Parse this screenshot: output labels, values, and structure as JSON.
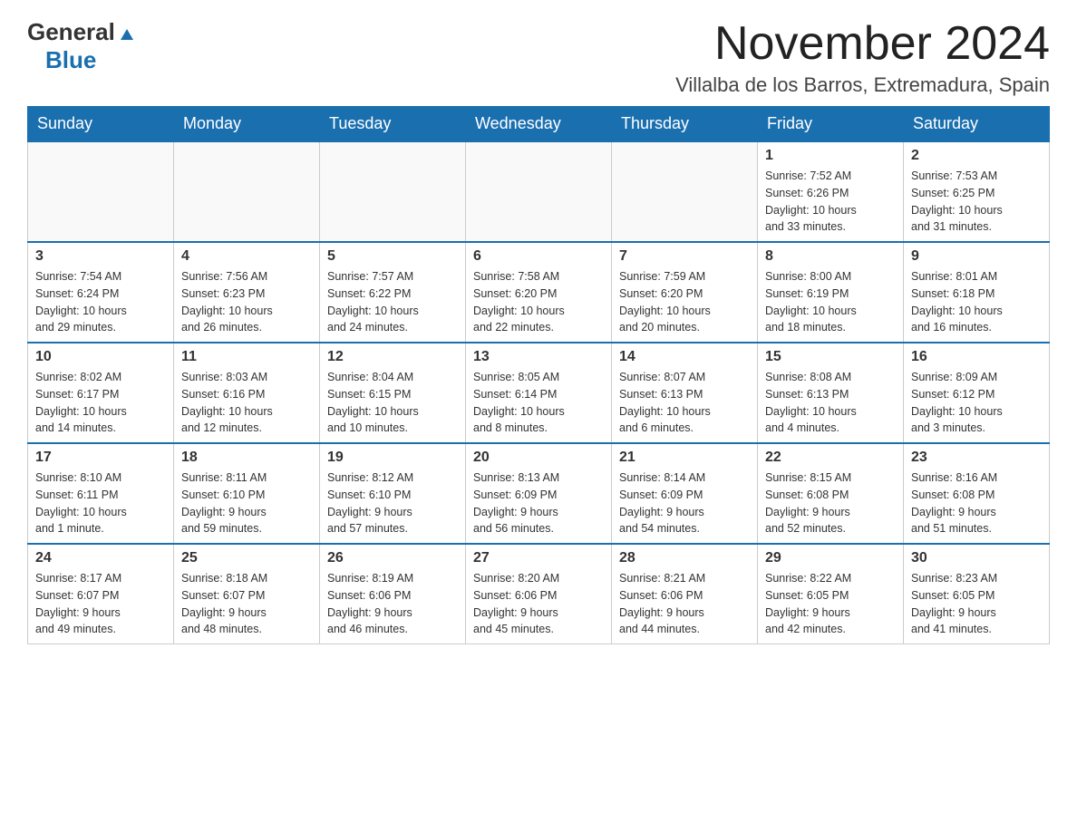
{
  "logo": {
    "general": "General",
    "triangle": "▲",
    "blue": "Blue"
  },
  "header": {
    "month_year": "November 2024",
    "location": "Villalba de los Barros, Extremadura, Spain"
  },
  "days_of_week": [
    "Sunday",
    "Monday",
    "Tuesday",
    "Wednesday",
    "Thursday",
    "Friday",
    "Saturday"
  ],
  "weeks": [
    {
      "days": [
        {
          "num": "",
          "info": ""
        },
        {
          "num": "",
          "info": ""
        },
        {
          "num": "",
          "info": ""
        },
        {
          "num": "",
          "info": ""
        },
        {
          "num": "",
          "info": ""
        },
        {
          "num": "1",
          "info": "Sunrise: 7:52 AM\nSunset: 6:26 PM\nDaylight: 10 hours\nand 33 minutes."
        },
        {
          "num": "2",
          "info": "Sunrise: 7:53 AM\nSunset: 6:25 PM\nDaylight: 10 hours\nand 31 minutes."
        }
      ]
    },
    {
      "days": [
        {
          "num": "3",
          "info": "Sunrise: 7:54 AM\nSunset: 6:24 PM\nDaylight: 10 hours\nand 29 minutes."
        },
        {
          "num": "4",
          "info": "Sunrise: 7:56 AM\nSunset: 6:23 PM\nDaylight: 10 hours\nand 26 minutes."
        },
        {
          "num": "5",
          "info": "Sunrise: 7:57 AM\nSunset: 6:22 PM\nDaylight: 10 hours\nand 24 minutes."
        },
        {
          "num": "6",
          "info": "Sunrise: 7:58 AM\nSunset: 6:20 PM\nDaylight: 10 hours\nand 22 minutes."
        },
        {
          "num": "7",
          "info": "Sunrise: 7:59 AM\nSunset: 6:20 PM\nDaylight: 10 hours\nand 20 minutes."
        },
        {
          "num": "8",
          "info": "Sunrise: 8:00 AM\nSunset: 6:19 PM\nDaylight: 10 hours\nand 18 minutes."
        },
        {
          "num": "9",
          "info": "Sunrise: 8:01 AM\nSunset: 6:18 PM\nDaylight: 10 hours\nand 16 minutes."
        }
      ]
    },
    {
      "days": [
        {
          "num": "10",
          "info": "Sunrise: 8:02 AM\nSunset: 6:17 PM\nDaylight: 10 hours\nand 14 minutes."
        },
        {
          "num": "11",
          "info": "Sunrise: 8:03 AM\nSunset: 6:16 PM\nDaylight: 10 hours\nand 12 minutes."
        },
        {
          "num": "12",
          "info": "Sunrise: 8:04 AM\nSunset: 6:15 PM\nDaylight: 10 hours\nand 10 minutes."
        },
        {
          "num": "13",
          "info": "Sunrise: 8:05 AM\nSunset: 6:14 PM\nDaylight: 10 hours\nand 8 minutes."
        },
        {
          "num": "14",
          "info": "Sunrise: 8:07 AM\nSunset: 6:13 PM\nDaylight: 10 hours\nand 6 minutes."
        },
        {
          "num": "15",
          "info": "Sunrise: 8:08 AM\nSunset: 6:13 PM\nDaylight: 10 hours\nand 4 minutes."
        },
        {
          "num": "16",
          "info": "Sunrise: 8:09 AM\nSunset: 6:12 PM\nDaylight: 10 hours\nand 3 minutes."
        }
      ]
    },
    {
      "days": [
        {
          "num": "17",
          "info": "Sunrise: 8:10 AM\nSunset: 6:11 PM\nDaylight: 10 hours\nand 1 minute."
        },
        {
          "num": "18",
          "info": "Sunrise: 8:11 AM\nSunset: 6:10 PM\nDaylight: 9 hours\nand 59 minutes."
        },
        {
          "num": "19",
          "info": "Sunrise: 8:12 AM\nSunset: 6:10 PM\nDaylight: 9 hours\nand 57 minutes."
        },
        {
          "num": "20",
          "info": "Sunrise: 8:13 AM\nSunset: 6:09 PM\nDaylight: 9 hours\nand 56 minutes."
        },
        {
          "num": "21",
          "info": "Sunrise: 8:14 AM\nSunset: 6:09 PM\nDaylight: 9 hours\nand 54 minutes."
        },
        {
          "num": "22",
          "info": "Sunrise: 8:15 AM\nSunset: 6:08 PM\nDaylight: 9 hours\nand 52 minutes."
        },
        {
          "num": "23",
          "info": "Sunrise: 8:16 AM\nSunset: 6:08 PM\nDaylight: 9 hours\nand 51 minutes."
        }
      ]
    },
    {
      "days": [
        {
          "num": "24",
          "info": "Sunrise: 8:17 AM\nSunset: 6:07 PM\nDaylight: 9 hours\nand 49 minutes."
        },
        {
          "num": "25",
          "info": "Sunrise: 8:18 AM\nSunset: 6:07 PM\nDaylight: 9 hours\nand 48 minutes."
        },
        {
          "num": "26",
          "info": "Sunrise: 8:19 AM\nSunset: 6:06 PM\nDaylight: 9 hours\nand 46 minutes."
        },
        {
          "num": "27",
          "info": "Sunrise: 8:20 AM\nSunset: 6:06 PM\nDaylight: 9 hours\nand 45 minutes."
        },
        {
          "num": "28",
          "info": "Sunrise: 8:21 AM\nSunset: 6:06 PM\nDaylight: 9 hours\nand 44 minutes."
        },
        {
          "num": "29",
          "info": "Sunrise: 8:22 AM\nSunset: 6:05 PM\nDaylight: 9 hours\nand 42 minutes."
        },
        {
          "num": "30",
          "info": "Sunrise: 8:23 AM\nSunset: 6:05 PM\nDaylight: 9 hours\nand 41 minutes."
        }
      ]
    }
  ]
}
